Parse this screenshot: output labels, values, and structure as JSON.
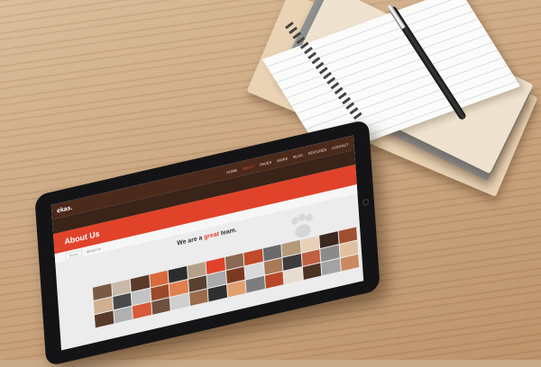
{
  "site": {
    "logo": "ekas.",
    "nav": [
      "HOME",
      "ABOUT",
      "PAGES",
      "WORK",
      "BLOG",
      "FEATURES",
      "CONTACT"
    ],
    "active_nav": "ABOUT",
    "hero_text": "",
    "page_title": "About Us",
    "breadcrumb": [
      "Home",
      "About Us"
    ],
    "team_heading_pre": "We are a ",
    "team_heading_accent": "great",
    "team_heading_post": " team.",
    "paragraph": ""
  },
  "notebook": {
    "handwriting": ""
  },
  "colors": {
    "accent": "#e0432a",
    "topbar": "#4b2a1c",
    "desk": "#c9a47e"
  },
  "photos": [
    "#7a5a45",
    "#c9b9a8",
    "#5b3a2a",
    "#d96a3a",
    "#2d2d2d",
    "#b7a08a",
    "#e0432a",
    "#8a6a55",
    "#c04a2a",
    "#6a6a6a",
    "#b59a7a",
    "#e9d0b8",
    "#3a2a20",
    "#a05030",
    "#d0b090",
    "#4a4a4a",
    "#c3c3c3",
    "#9a4a2a",
    "#e08050",
    "#5a4030",
    "#ababab",
    "#7a3a20",
    "#d9d9d9",
    "#a97a55",
    "#3d3d3d",
    "#c06040",
    "#8a8a8a",
    "#e0c0a0",
    "#5a3a2a",
    "#b0b0b0",
    "#d75a3a",
    "#6d5040",
    "#cfcfcf",
    "#9b6b4a",
    "#2f2f2f",
    "#e2a070",
    "#7d7d7d",
    "#b8482a",
    "#e6dccf",
    "#4d3325",
    "#a3a3a3",
    "#c98a60"
  ]
}
